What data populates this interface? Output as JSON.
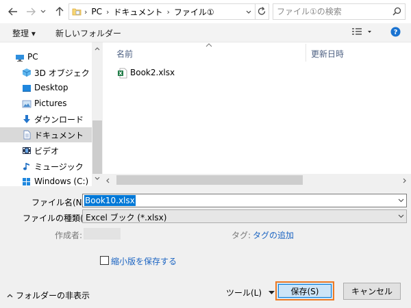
{
  "address": {
    "crumbs": [
      "PC",
      "ドキュメント",
      "ファイル①"
    ]
  },
  "search": {
    "placeholder": "ファイル①の検索"
  },
  "commands": {
    "organize": "整理 ▾",
    "new_folder": "新しいフォルダー"
  },
  "nav": {
    "items": [
      {
        "label": "PC",
        "icon": "pc-icon"
      },
      {
        "label": "3D オブジェクト",
        "icon": "3d-objects-icon"
      },
      {
        "label": "Desktop",
        "icon": "desktop-icon"
      },
      {
        "label": "Pictures",
        "icon": "pictures-icon"
      },
      {
        "label": "ダウンロード",
        "icon": "download-icon"
      },
      {
        "label": "ドキュメント",
        "icon": "documents-icon",
        "selected": true
      },
      {
        "label": "ビデオ",
        "icon": "video-icon"
      },
      {
        "label": "ミュージック",
        "icon": "music-icon"
      },
      {
        "label": "Windows (C:)",
        "icon": "drive-icon"
      }
    ]
  },
  "files": {
    "columns": {
      "name": "名前",
      "date": "更新日時"
    },
    "rows": [
      {
        "name": "Book2.xlsx",
        "icon": "excel-file-icon"
      }
    ]
  },
  "form": {
    "filename_label": "ファイル名(N):",
    "filename_value": "Book10.xlsx",
    "filetype_label": "ファイルの種類(T):",
    "filetype_value": "Excel ブック (*.xlsx)",
    "author_label": "作成者:",
    "tags_label": "タグ:",
    "tags_value": "タグの追加",
    "thumbnail_label": "縮小版を保存する",
    "hide_folders": "フォルダーの非表示",
    "tools": "ツール(L)",
    "save": "保存(S)",
    "cancel": "キャンセル"
  },
  "colors": {
    "accent": "#0078d7",
    "highlight_outline": "#ef7a23",
    "link": "#1b64c2"
  }
}
